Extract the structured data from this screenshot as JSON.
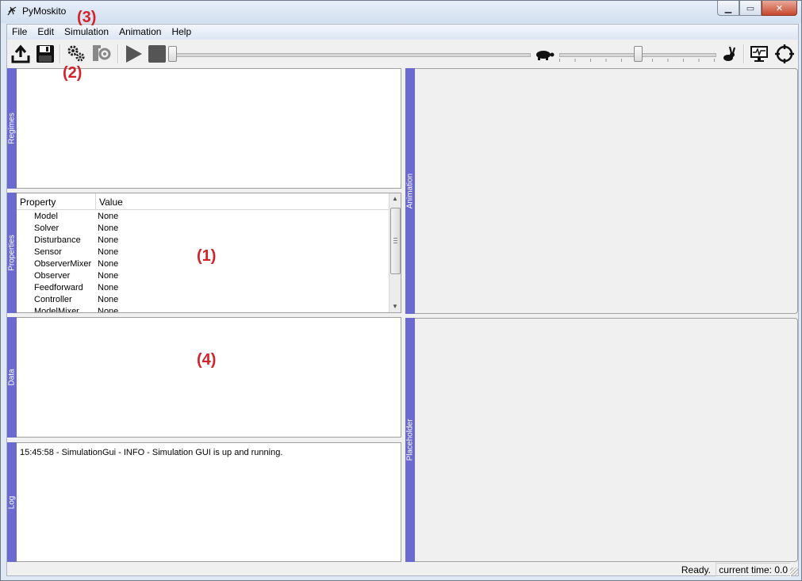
{
  "window": {
    "title": "PyMoskito"
  },
  "menu": [
    "File",
    "Edit",
    "Simulation",
    "Animation",
    "Help"
  ],
  "toolbar": {
    "icons": [
      "upload-icon",
      "save-icon",
      "gears-icon",
      "settings-animate-icon",
      "play-icon",
      "stop-icon",
      "turtle-icon",
      "rabbit-icon",
      "monitor-icon",
      "crosshair-icon"
    ],
    "speed_level": 0.5
  },
  "docks": {
    "regimes": "Regimes",
    "properties": "Properties",
    "data": "Data",
    "log": "Log",
    "animation": "Animation",
    "placeholder": "Placeholder"
  },
  "properties": {
    "header_property": "Property",
    "header_value": "Value",
    "rows": [
      {
        "key": "Model",
        "value": "None"
      },
      {
        "key": "Solver",
        "value": "None"
      },
      {
        "key": "Disturbance",
        "value": "None"
      },
      {
        "key": "Sensor",
        "value": "None"
      },
      {
        "key": "ObserverMixer",
        "value": "None"
      },
      {
        "key": "Observer",
        "value": "None"
      },
      {
        "key": "Feedforward",
        "value": "None"
      },
      {
        "key": "Controller",
        "value": "None"
      },
      {
        "key": "ModelMixer",
        "value": "None"
      }
    ]
  },
  "log": {
    "lines": [
      "15:45:58 - SimulationGui - INFO - Simulation GUI is up and running."
    ]
  },
  "annotations": {
    "a1": "(1)",
    "a2": "(2)",
    "a3": "(3)",
    "a4": "(4)"
  },
  "status": {
    "ready": "Ready.",
    "current_time": "current time: 0.0"
  },
  "colors": {
    "dock_tab": "#6a6ad0",
    "annotation": "#d2232a"
  }
}
